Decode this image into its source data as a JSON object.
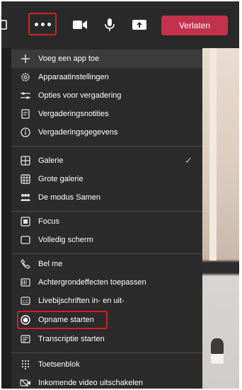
{
  "toolbar": {
    "leave_label": "Verlaten"
  },
  "menu": {
    "items": [
      {
        "label": "Voeg een app toe",
        "icon": "plus-icon"
      },
      {
        "label": "Apparaatinstellingen",
        "icon": "gear-icon"
      },
      {
        "label": "Opties voor vergadering",
        "icon": "sliders-icon"
      },
      {
        "label": "Vergaderingsnotities",
        "icon": "notes-icon"
      },
      {
        "label": "Vergaderingsgegevens",
        "icon": "info-icon"
      },
      {
        "label": "Galerie",
        "icon": "gallery-icon",
        "checked": true
      },
      {
        "label": "Grote galerie",
        "icon": "large-gallery-icon"
      },
      {
        "label": "De modus Samen",
        "icon": "together-mode-icon"
      },
      {
        "label": "Focus",
        "icon": "focus-icon"
      },
      {
        "label": "Volledig scherm",
        "icon": "fullscreen-icon"
      },
      {
        "label": "Bel me",
        "icon": "phone-icon"
      },
      {
        "label": "Achtergrondeffecten toepassen",
        "icon": "background-effects-icon"
      },
      {
        "label": "Livebijschriften in- en uit-",
        "icon": "captions-icon"
      },
      {
        "label": "Opname starten",
        "icon": "record-icon",
        "highlighted_box": true
      },
      {
        "label": "Transcriptie starten",
        "icon": "transcript-icon"
      },
      {
        "label": "Toetsenblok",
        "icon": "dialpad-icon"
      },
      {
        "label": "Inkomende video uitschakelen",
        "icon": "video-off-icon"
      }
    ]
  },
  "colors": {
    "accent_red": "#d42027",
    "leave_button": "#c4314b",
    "menu_bg": "#2b2b2b"
  }
}
